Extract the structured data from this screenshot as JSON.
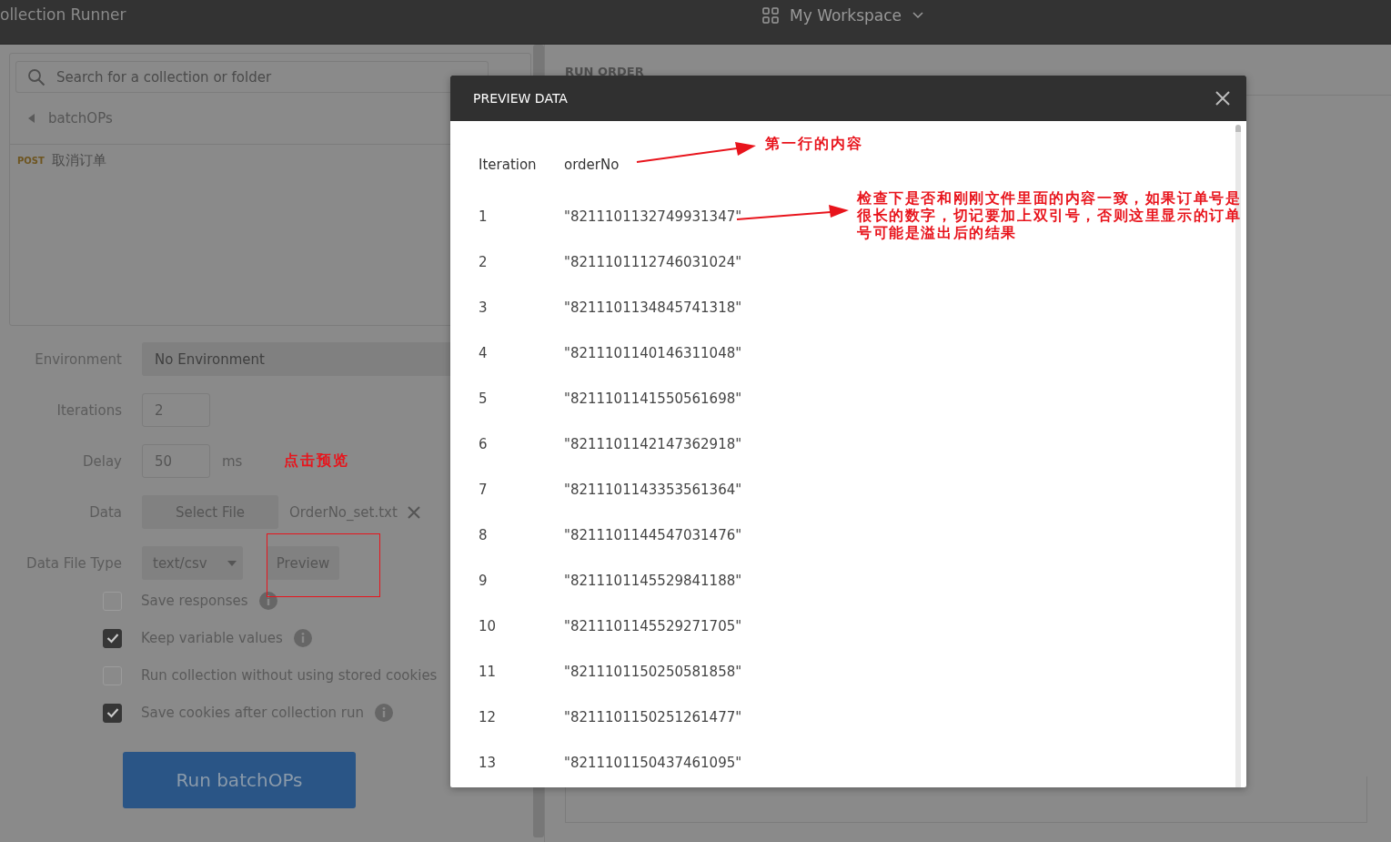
{
  "app": {
    "title": "ollection Runner",
    "workspace": "My Workspace"
  },
  "collection_search": {
    "placeholder": "Search for a collection or folder"
  },
  "breadcrumb": "batchOPs",
  "requests": [
    {
      "method": "POST",
      "name": "取消订单"
    }
  ],
  "form": [
    {
      "kind": "select",
      "label": "Environment",
      "value": "No Environment"
    },
    {
      "kind": "input",
      "label": "Iterations",
      "value": "2"
    },
    {
      "kind": "input",
      "label": "Delay",
      "value": "50",
      "unit": "ms"
    },
    {
      "kind": "file",
      "label": "Data",
      "button": "Select File",
      "file": "OrderNo_set.txt"
    },
    {
      "kind": "dropdown",
      "label": "Data File Type",
      "value": "text/csv",
      "button": "Preview"
    }
  ],
  "options": [
    {
      "label": "Save responses",
      "checked": false,
      "info": true
    },
    {
      "label": "Keep variable values",
      "checked": true,
      "info": true
    },
    {
      "label": "Run collection without using stored cookies",
      "checked": false,
      "info": false
    },
    {
      "label": "Save cookies after collection run",
      "checked": true,
      "info": true
    }
  ],
  "run_button": "Run batchOPs",
  "run_order": {
    "title": "RUN ORDER"
  },
  "modal": {
    "title": "PREVIEW DATA",
    "columns": [
      "Iteration",
      "orderNo"
    ],
    "rows": [
      [
        "1",
        "\"8211101132749931347\""
      ],
      [
        "2",
        "\"8211101112746031024\""
      ],
      [
        "3",
        "\"8211101134845741318\""
      ],
      [
        "4",
        "\"8211101140146311048\""
      ],
      [
        "5",
        "\"8211101141550561698\""
      ],
      [
        "6",
        "\"8211101142147362918\""
      ],
      [
        "7",
        "\"8211101143353561364\""
      ],
      [
        "8",
        "\"8211101144547031476\""
      ],
      [
        "9",
        "\"8211101145529841188\""
      ],
      [
        "10",
        "\"8211101145529271705\""
      ],
      [
        "11",
        "\"8211101150250581858\""
      ],
      [
        "12",
        "\"8211101150251261477\""
      ],
      [
        "13",
        "\"8211101150437461095\""
      ]
    ]
  },
  "annotations": [
    {
      "kind": "preview-note",
      "text": "点击预览"
    },
    {
      "kind": "header-note",
      "text": "第一行的内容"
    },
    {
      "kind": "row-note",
      "text": "检查下是否和刚刚文件里面的内容一致，如果订单号是很长的数字，切记要加上双引号，否则这里显示的订单号可能是溢出后的结果"
    }
  ]
}
